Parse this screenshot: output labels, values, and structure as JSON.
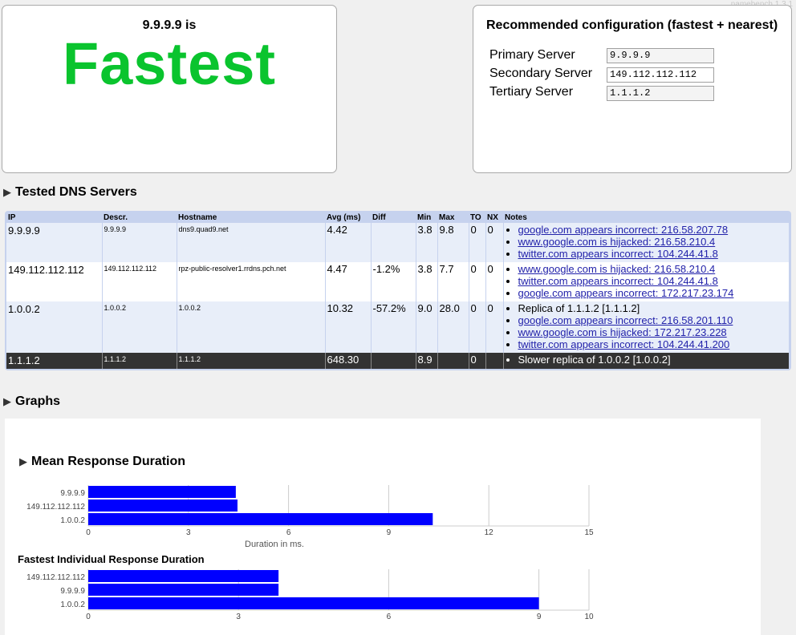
{
  "header": {
    "version": "namebench 1.3.1"
  },
  "summary": {
    "ip_line": "9.9.9.9 is",
    "verdict": "Fastest"
  },
  "config": {
    "title": "Recommended configuration (fastest + nearest)",
    "primary_label": "Primary Server",
    "primary_value": "9.9.9.9",
    "secondary_label": "Secondary Server",
    "secondary_value": "149.112.112.112",
    "tertiary_label": "Tertiary Server",
    "tertiary_value": "1.1.1.2"
  },
  "tested": {
    "heading": "Tested DNS Servers",
    "columns": [
      "IP",
      "Descr.",
      "Hostname",
      "Avg (ms)",
      "Diff",
      "Min",
      "Max",
      "TO",
      "NX",
      "Notes"
    ],
    "rows": [
      {
        "ip": "9.9.9.9",
        "descr": "9.9.9.9",
        "hostname": "dns9.quad9.net",
        "avg": "4.42",
        "diff": "",
        "min": "3.8",
        "max": "9.8",
        "to": "0",
        "nx": "0",
        "notes": [
          "google.com appears incorrect: 216.58.207.78",
          "www.google.com is hijacked: 216.58.210.4",
          "twitter.com appears incorrect: 104.244.41.8"
        ]
      },
      {
        "ip": "149.112.112.112",
        "descr": "149.112.112.112",
        "hostname": "rpz-public-resolver1.rrdns.pch.net",
        "avg": "4.47",
        "diff": "-1.2%",
        "min": "3.8",
        "max": "7.7",
        "to": "0",
        "nx": "0",
        "notes": [
          "www.google.com is hijacked: 216.58.210.4",
          "twitter.com appears incorrect: 104.244.41.8",
          "google.com appears incorrect: 172.217.23.174"
        ]
      },
      {
        "ip": "1.0.0.2",
        "descr": "1.0.0.2",
        "hostname": "1.0.0.2",
        "avg": "10.32",
        "diff": "-57.2%",
        "min": "9.0",
        "max": "28.0",
        "to": "0",
        "nx": "0",
        "note_plain": "Replica of 1.1.1.2 [1.1.1.2]",
        "notes": [
          "google.com appears incorrect: 216.58.201.110",
          "www.google.com is hijacked: 172.217.23.228",
          "twitter.com appears incorrect: 104.244.41.200"
        ]
      },
      {
        "ip": "1.1.1.2",
        "descr": "1.1.1.2",
        "hostname": "1.1.1.2",
        "avg": "648.30",
        "diff": "",
        "min": "8.9",
        "max": "",
        "to": "0",
        "nx": "",
        "note_plain": "Slower replica of 1.0.0.2 [1.0.0.2]"
      }
    ]
  },
  "graphs": {
    "heading": "Graphs"
  },
  "chart_data": [
    {
      "type": "bar",
      "orientation": "horizontal",
      "title": "Mean Response Duration",
      "categories": [
        "9.9.9.9",
        "149.112.112.112",
        "1.0.0.2"
      ],
      "values": [
        4.42,
        4.47,
        10.32
      ],
      "xlabel": "Duration in ms.",
      "xlim": [
        0,
        15
      ],
      "xticks": [
        "0",
        "3",
        "6",
        "9",
        "12",
        "15"
      ],
      "color": "#0000ff",
      "grid": true
    },
    {
      "type": "bar",
      "orientation": "horizontal",
      "title": "Fastest Individual Response Duration",
      "categories": [
        "149.112.112.112",
        "9.9.9.9",
        "1.0.0.2"
      ],
      "values": [
        3.8,
        3.8,
        9.0
      ],
      "xlim": [
        0,
        10
      ],
      "xticks": [
        "0",
        "3",
        "6",
        "9",
        "10"
      ],
      "color": "#0000ff",
      "grid": true
    }
  ]
}
